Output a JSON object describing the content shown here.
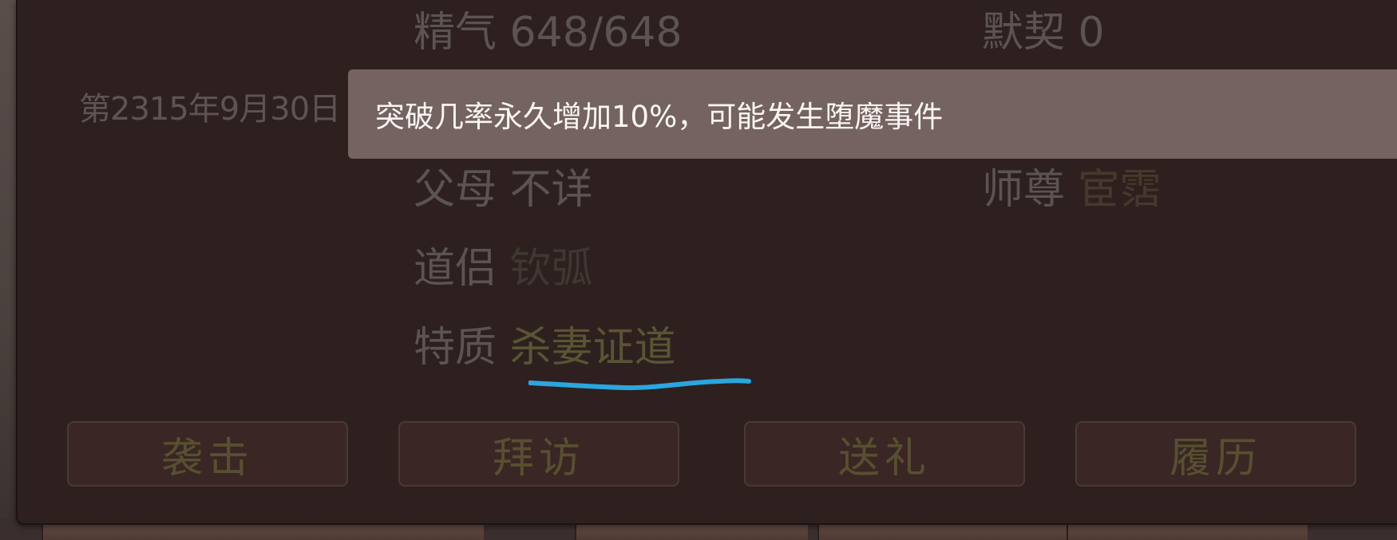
{
  "dialog": {
    "date": "第2315年9月30日",
    "stats": {
      "jingqi_label": "精气",
      "jingqi_value": "648/648",
      "moqi_label": "默契",
      "moqi_value": "0",
      "parents_label": "父母",
      "parents_value": "不详",
      "master_label": "师尊",
      "master_value": "宦霑",
      "daolu_label": "道侣",
      "daolu_value": "钦弧",
      "trait_label": "特质",
      "trait_value": "杀妻证道"
    },
    "buttons": {
      "attack": "袭击",
      "visit": "拜访",
      "gift": "送礼",
      "history": "履历"
    }
  },
  "tooltip": {
    "text": "突破几率永久增加10%，可能发生堕魔事件"
  },
  "colors": {
    "panel_bg": "#2e201e",
    "tooltip_bg": "#756361",
    "annotation_underline": "#2aa6e0",
    "gold_text": "#5b5434"
  }
}
